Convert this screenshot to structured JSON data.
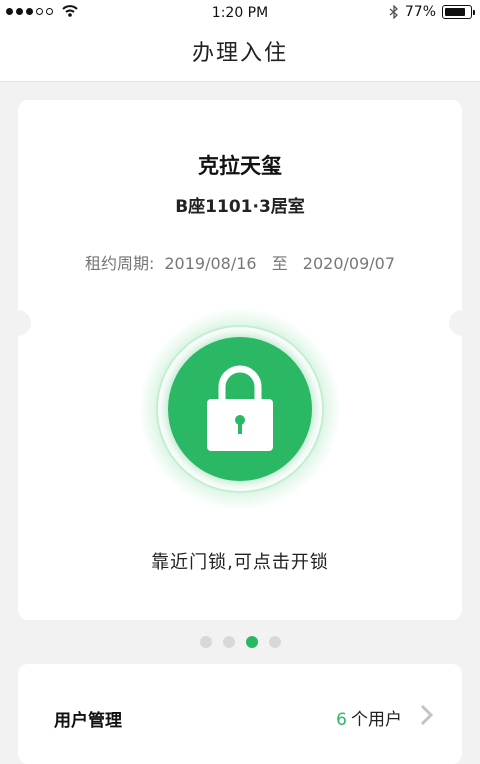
{
  "status_bar": {
    "time": "1:20 PM",
    "battery": "77%",
    "signal_dots_filled": 3,
    "signal_dots_total": 5
  },
  "nav": {
    "title": "办理入住"
  },
  "card": {
    "title": "克拉天玺",
    "room": "B座1101·3居室",
    "period_label": "租约周期:",
    "start_date": "2019/08/16",
    "separator": "至",
    "end_date": "2020/09/07",
    "hint": "靠近门锁,可点击开锁"
  },
  "pager": {
    "count": 4,
    "active_index": 2
  },
  "user_mgmt": {
    "label": "用户管理",
    "count": "6",
    "unit": "个用户"
  },
  "colors": {
    "accent": "#2bb865",
    "background": "#f2f2f2"
  },
  "icons": {
    "lock": "lock-icon",
    "chevron": "chevron-right-icon",
    "wifi": "wifi-icon",
    "bluetooth": "bluetooth-icon"
  }
}
